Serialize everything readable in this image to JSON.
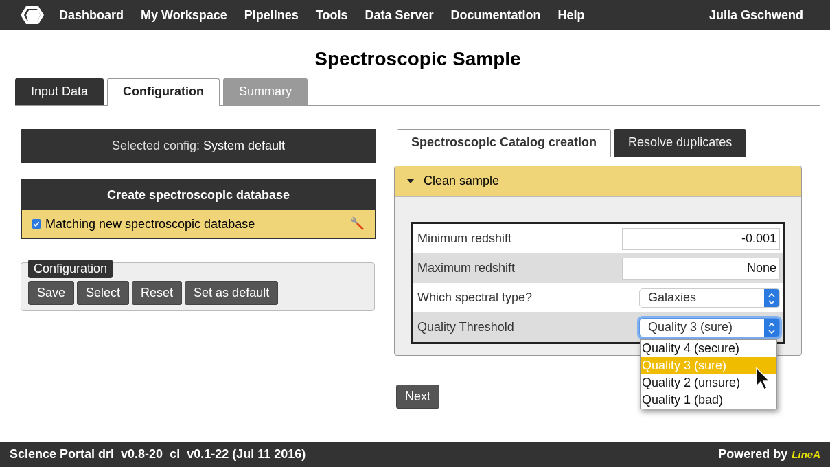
{
  "nav": {
    "items": [
      "Dashboard",
      "My Workspace",
      "Pipelines",
      "Tools",
      "Data Server",
      "Documentation",
      "Help"
    ],
    "user": "Julia Gschwend"
  },
  "page_title": "Spectroscopic Sample",
  "tabs": [
    {
      "label": "Input Data",
      "selected": false,
      "disabled": false
    },
    {
      "label": "Configuration",
      "selected": true,
      "disabled": false
    },
    {
      "label": "Summary",
      "selected": false,
      "disabled": true
    }
  ],
  "selected_config": {
    "label": "Selected config:",
    "value": "System default"
  },
  "section": {
    "title": "Create spectroscopic database",
    "items": [
      {
        "label": "Matching new spectroscopic database",
        "checked": true
      }
    ]
  },
  "config_group": {
    "legend": "Configuration",
    "buttons": [
      "Save",
      "Select",
      "Reset",
      "Set as default"
    ]
  },
  "subtabs": [
    {
      "label": "Spectroscopic Catalog creation",
      "selected": true
    },
    {
      "label": "Resolve duplicates",
      "selected": false
    }
  ],
  "panel": {
    "title": "Clean sample",
    "expanded": true,
    "fields": [
      {
        "kind": "input",
        "label": "Minimum redshift",
        "value": "-0.001"
      },
      {
        "kind": "input",
        "label": "Maximum redshift",
        "value": "None"
      },
      {
        "kind": "select",
        "label": "Which spectral type?",
        "value": "Galaxies",
        "focused": false
      },
      {
        "kind": "select",
        "label": "Quality Threshold",
        "value": "Quality 3 (sure)",
        "focused": true,
        "options": [
          {
            "label": "Quality 4 (secure)",
            "selected": false
          },
          {
            "label": "Quality 3 (sure)",
            "selected": true
          },
          {
            "label": "Quality 2 (unsure)",
            "selected": false
          },
          {
            "label": "Quality 1 (bad)",
            "selected": false
          }
        ]
      }
    ]
  },
  "next_button": "Next",
  "footer": {
    "version": "Science Portal dri_v0.8-20_ci_v0.1-22 (Jul 11 2016)",
    "powered_by": "Powered by",
    "brand": "LineA"
  }
}
